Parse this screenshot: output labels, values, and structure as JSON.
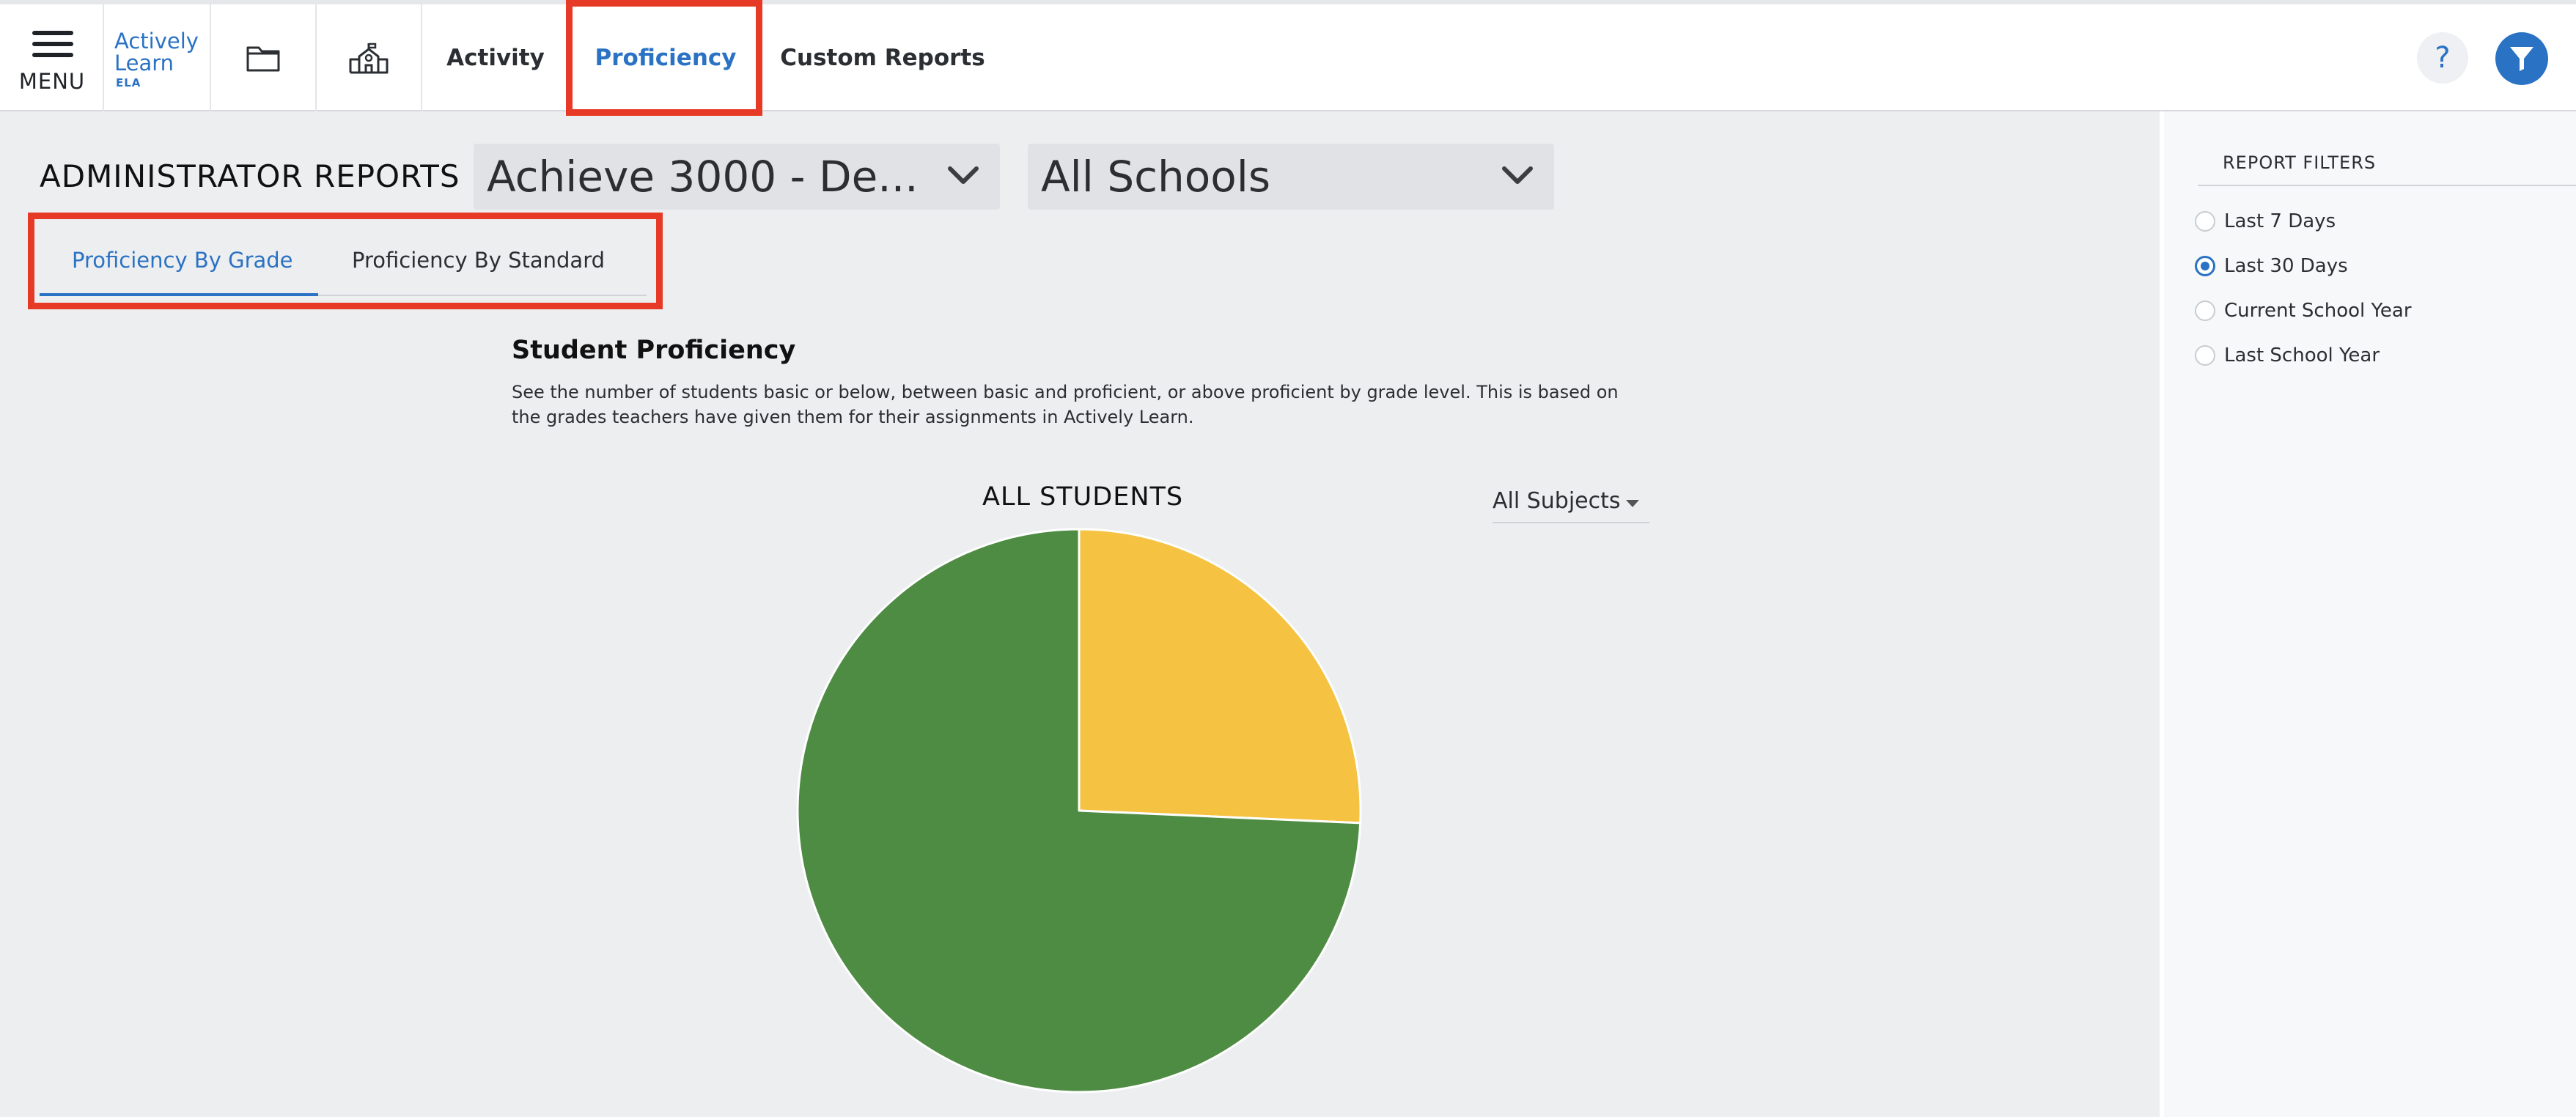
{
  "nav": {
    "menu_label": "MENU",
    "logo": {
      "line1": "Actively",
      "line2": "Learn",
      "sub": "ELA"
    },
    "icons": [
      "folder-icon",
      "school-icon"
    ],
    "tabs": [
      {
        "label": "Activity",
        "active": false
      },
      {
        "label": "Proficiency",
        "active": true
      },
      {
        "label": "Custom Reports",
        "active": false
      }
    ],
    "help_label": "?"
  },
  "main": {
    "title": "ADMINISTRATOR REPORTS",
    "district_select": "Achieve 3000 - De...",
    "school_select": "All Schools",
    "subtabs": [
      {
        "label": "Proficiency By Grade",
        "active": true
      },
      {
        "label": "Proficiency By Standard",
        "active": false
      }
    ],
    "section_title": "Student Proficiency",
    "section_desc": "See the number of students basic or below, between basic and proficient, or above proficient by grade level. This is based on the grades teachers have given them for their assignments in Actively Learn.",
    "chart_title": "ALL STUDENTS",
    "subject_select": "All Subjects"
  },
  "chart_data": {
    "type": "pie",
    "title": "ALL STUDENTS",
    "slices": [
      {
        "value": 25.7,
        "color": "#f5c242"
      },
      {
        "value": 74.3,
        "color": "#4f8c43"
      }
    ]
  },
  "filters": {
    "title": "REPORT FILTERS",
    "options": [
      {
        "label": "Last 7 Days",
        "checked": false
      },
      {
        "label": "Last 30 Days",
        "checked": true
      },
      {
        "label": "Current School Year",
        "checked": false
      },
      {
        "label": "Last School Year",
        "checked": false
      }
    ]
  },
  "colors": {
    "accent": "#2a72c4",
    "highlight": "#e63a26"
  }
}
